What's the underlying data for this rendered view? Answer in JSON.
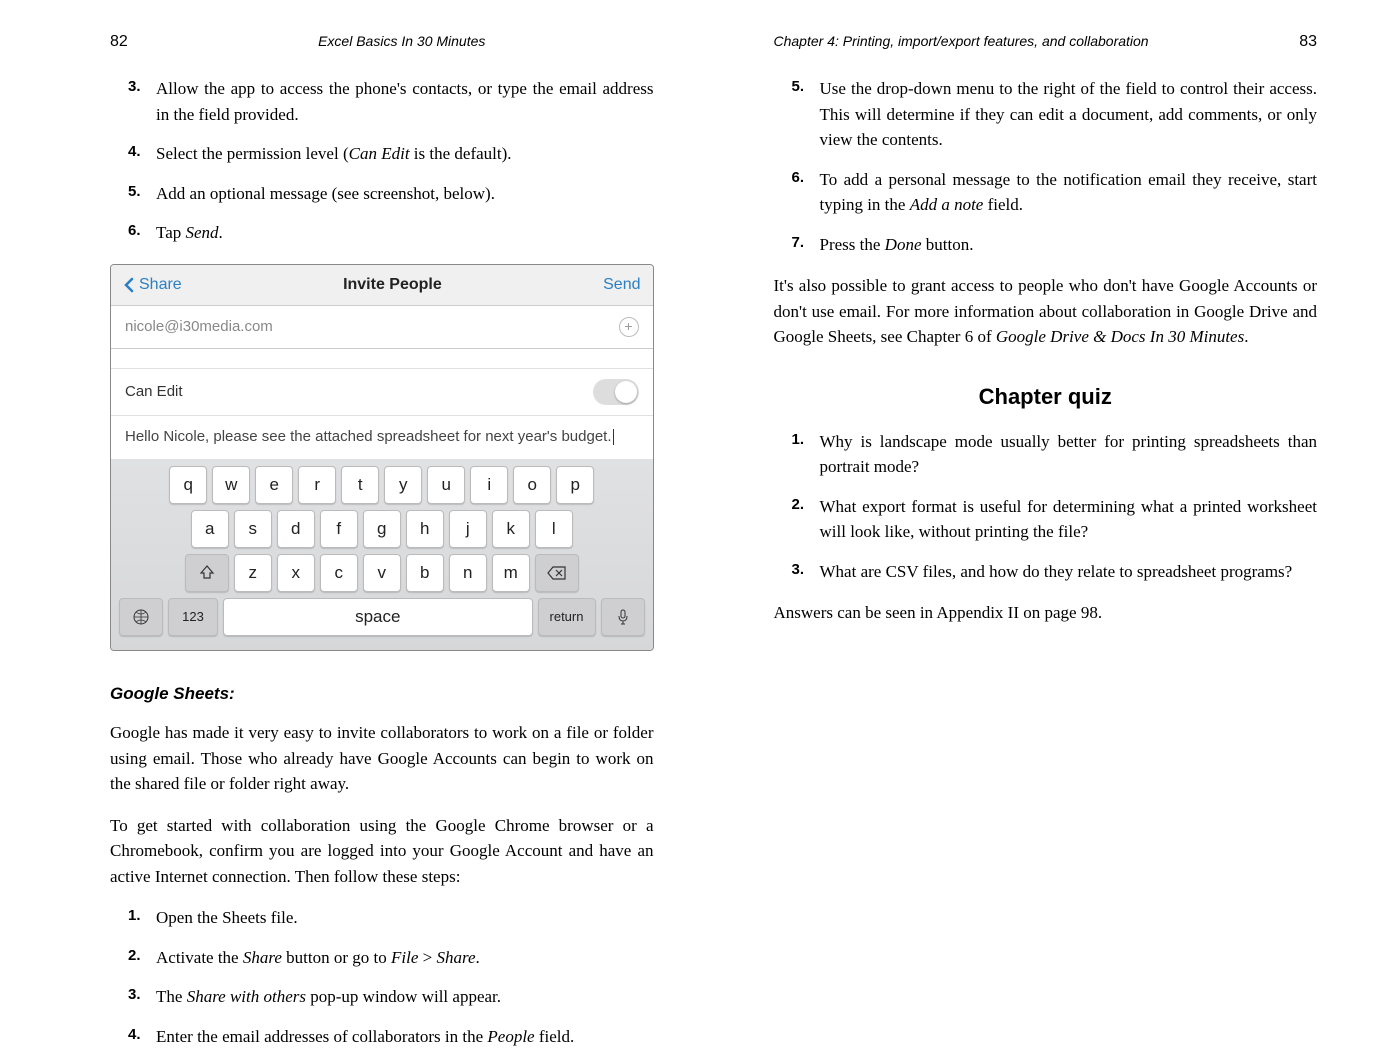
{
  "left": {
    "page_no": "82",
    "running_title": "Excel Basics In 30 Minutes",
    "steps_a": [
      {
        "n": "3.",
        "t": "Allow the app to access the phone's contacts, or type the email address in the field provided."
      },
      {
        "n": "4.",
        "t_pre": "Select the permission level (",
        "t_em": "Can Edit",
        "t_post": " is the default)."
      },
      {
        "n": "5.",
        "t": "Add an optional message (see screenshot, below)."
      },
      {
        "n": "6.",
        "t_pre": "Tap ",
        "t_em": "Send",
        "t_post": "."
      }
    ],
    "screenshot": {
      "back": "Share",
      "title": "Invite People",
      "send": "Send",
      "email": "nicole@i30media.com",
      "permission": "Can Edit",
      "message": "Hello Nicole, please see the attached spreadsheet for next year's budget.",
      "rows": {
        "r1": [
          "q",
          "w",
          "e",
          "r",
          "t",
          "y",
          "u",
          "i",
          "o",
          "p"
        ],
        "r2": [
          "a",
          "s",
          "d",
          "f",
          "g",
          "h",
          "j",
          "k",
          "l"
        ],
        "r3": [
          "z",
          "x",
          "c",
          "v",
          "b",
          "n",
          "m"
        ]
      },
      "key_123": "123",
      "key_space": "space",
      "key_return": "return"
    },
    "gs_heading": "Google Sheets:",
    "gs_p1": "Google has made it very easy to invite collaborators to work on a file or folder using email. Those who already have Google Accounts can begin to work on the shared file or folder right away.",
    "gs_p2": "To get started with collaboration using the Google Chrome browser or a Chromebook, confirm you are logged into your Google Account and have an active Internet connection. Then follow these steps:",
    "steps_b": [
      {
        "n": "1.",
        "t": "Open the Sheets file."
      },
      {
        "n": "2.",
        "t_pre": "Activate the ",
        "t_em": "Share",
        "t_mid": " button or go to ",
        "t_em2": "File",
        "t_gt": " > ",
        "t_em3": "Share",
        "t_post": "."
      },
      {
        "n": "3.",
        "t_pre": "The ",
        "t_em": "Share with others",
        "t_post": " pop-up window will appear."
      },
      {
        "n": "4.",
        "t_pre": "Enter the email addresses of collaborators in the ",
        "t_em": "People",
        "t_post": " field."
      }
    ]
  },
  "right": {
    "running_title": "Chapter 4: Printing, import/export features, and collaboration",
    "page_no": "83",
    "steps": [
      {
        "n": "5.",
        "t": "Use the drop-down menu to the right of the field to control their access. This will determine if they can edit a document, add comments, or only view the contents."
      },
      {
        "n": "6.",
        "t_pre": "To add a personal message to the notification email they receive, start typing in the ",
        "t_em": "Add a note",
        "t_post": " field."
      },
      {
        "n": "7.",
        "t_pre": "Press the ",
        "t_em": "Done",
        "t_post": " button."
      }
    ],
    "p1_pre": "It's also possible to grant access to people who don't have Google Accounts or don't use email. For more information about collaboration in Google Drive and Google Sheets, see Chapter 6 of ",
    "p1_em": "Google Drive & Docs In 30 Minutes",
    "p1_post": ".",
    "quiz_heading": "Chapter quiz",
    "quiz": [
      {
        "n": "1.",
        "t": "Why is landscape mode usually better for printing spreadsheets than portrait mode?"
      },
      {
        "n": "2.",
        "t": "What export format is useful for determining what a printed work­sheet will look like, without printing the file?"
      },
      {
        "n": "3.",
        "t": "What are CSV files, and how do they relate to spreadsheet programs?"
      }
    ],
    "answers": "Answers can be seen in Appendix II on page 98."
  }
}
